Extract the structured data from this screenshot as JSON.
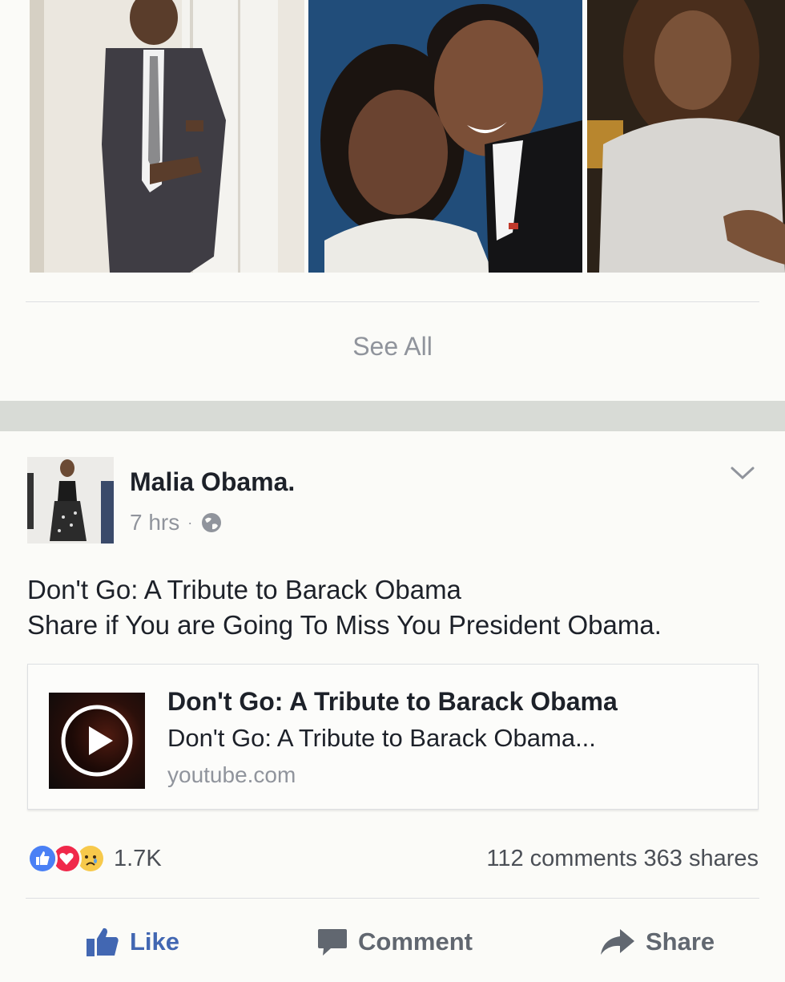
{
  "photos": [
    {
      "subject": "man-in-suit-photo"
    },
    {
      "subject": "couple-photo"
    },
    {
      "subject": "girl-photo"
    }
  ],
  "see_all_label": "See All",
  "post": {
    "author": "Malia Obama.",
    "time": "7 hrs",
    "separator": "·",
    "privacy_icon": "globe-icon",
    "menu_icon": "chevron-down-icon",
    "text_line_1": "Don't Go: A Tribute to Barack Obama",
    "text_line_2": "Share if You are Going To Miss You President Obama.",
    "link": {
      "title": "Don't Go: A Tribute to Barack Obama",
      "description": "Don't Go: A Tribute to Barack Obama...",
      "domain": "youtube.com",
      "thumb_icon": "play-icon"
    },
    "reactions": {
      "types": [
        "like",
        "love",
        "sad"
      ],
      "count": "1.7K"
    },
    "comments": "112 comments",
    "shares": "363 shares"
  },
  "actions": {
    "like": "Like",
    "comment": "Comment",
    "share": "Share"
  },
  "colors": {
    "facebook_blue": "#4267b2",
    "love_red": "#f0284a",
    "sad_yellow": "#f7c94b",
    "muted_text": "#90949c"
  }
}
